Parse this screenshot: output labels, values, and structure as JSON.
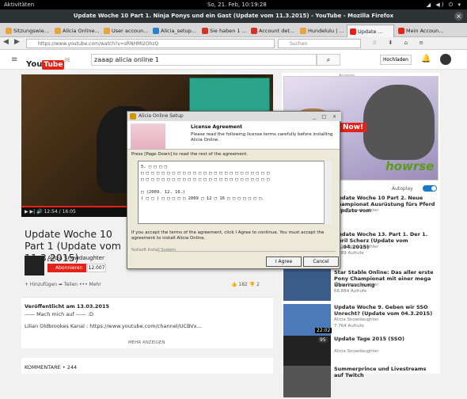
{
  "desktop": {
    "activities": "Aktivitäten",
    "clock": "So, 21. Feb, 10:19:28",
    "sys_icons": "◢ ◀) ⏻ ▾"
  },
  "window": {
    "title": "Update Woche 10 Part 1. Ninja Ponys und ein Gast (Update vom 11.3.2015) - YouTube - Mozilla Firefox",
    "close": "×"
  },
  "tabs": [
    {
      "label": "Sitzungswie...",
      "color": "#e8a33d"
    },
    {
      "label": "Alicia Online...",
      "color": "#e8a33d"
    },
    {
      "label": "User accoun...",
      "color": "#e8a33d"
    },
    {
      "label": "Alicia_setup...",
      "color": "#2a7fd1"
    },
    {
      "label": "Sie haben 1 ...",
      "color": "#d93025"
    },
    {
      "label": "Account det...",
      "color": "#d93025"
    },
    {
      "label": "Hundelulu | ...",
      "color": "#e8a33d"
    },
    {
      "label": "Update ...",
      "color": "#e62117"
    },
    {
      "label": "Mein Accoun...",
      "color": "#e62117"
    }
  ],
  "tab_new": "+",
  "tab_menu": "▾",
  "nav": {
    "back": "◀",
    "forward": "▶",
    "url": "https://www.youtube.com/watch?v=sRNHMI2OhzQ",
    "search_placeholder": "Suchen",
    "tools": "☆ ⬇ ⌂ ≡"
  },
  "youtube": {
    "logo_you": "You",
    "logo_tube": "Tube",
    "logo_region": "DE",
    "search_value": "zaaap alicia online 1",
    "upload": "Hochladen"
  },
  "video": {
    "time": "▶  ▶|  🔊   12:54 / 16:05",
    "progress_fraction": 0.6,
    "title": "Update Woche 10 Part 1 (Update vom 11.3.2015)",
    "channel": "Alicia Snowdaughter",
    "subscribe": "Abonnieren",
    "subscribers": "12.007",
    "actions": "+ Hinzufügen    ➦ Teilen    ••• Mehr",
    "likes": "👍 182    👎 2",
    "published": "Veröffentlicht am 13.03.2015",
    "desc1": "—— Mach mich auf —— :D",
    "desc2": "Lilian Oldbrookes Kanal : https://www.youtube.com/channel/UCBVx...",
    "more": "MEHR ANZEIGEN",
    "comments": "KOMMENTARE • 244"
  },
  "sidebar": {
    "ad_label": "Anzeige",
    "ad_now": "Now!",
    "ad_brand": "howrse",
    "autoplay": "Autoplay",
    "recs": [
      {
        "title": "Update Woche 10 Part 2. Neue Championat Ausrüstung fürs Pferd (Update vom",
        "channel": "Alicia Snowdaughter",
        "views": "",
        "dur": "",
        "color": "#3a2a1a"
      },
      {
        "title": "Update Woche 13. Part 1. Der 1. April Scherz (Update vom 01.04.2015)",
        "channel": "Alicia Snowdaughter",
        "views": "6.289 Aufrufe",
        "dur": "",
        "color": "#5a6b3a"
      },
      {
        "title": "Star Stable Online: Das aller erste Pony Championat mit einer mega Überraschung",
        "channel": "Alicia Snowdaughter",
        "views": "66.884 Aufrufe",
        "dur": "",
        "color": "#3b5c8a"
      },
      {
        "title": "Update Woche 9. Geben wir SSO Unrecht? (Update vom 04.3.2015)",
        "channel": "Alicia Snowdaughter",
        "views": "7.764 Aufrufe",
        "dur": "22:02",
        "color": "#4a7ab8"
      },
      {
        "title": "Update Tage 2015 (SSO)",
        "channel": "Alicia Snowdaughter",
        "views": "",
        "dur": "",
        "color": "#222"
      },
      {
        "title": "Summerprince und Livestreams auf Twitch",
        "channel": "",
        "views": "",
        "dur": "",
        "color": "#555"
      }
    ],
    "rec_badge": "95"
  },
  "dialog": {
    "title": "Alicia Online Setup",
    "buttons": "_ □ ×",
    "head1": "License Agreement",
    "head2": "Please read the following license terms carefully before installing Alicia Online.",
    "instr": "Press [Page Down] to read the rest of the agreement.",
    "text_lines": [
      "5. □ □ □ □",
      "□ □ □ □ □ □ □ □ □ □ □ □ □ □ □ □ □ □ □ □ □ □ □ □ □",
      "□ □ □ □ □ □ □ □ □ □ □ □ □ □ □ □ □ □ □ □ □ □ □ □ □",
      "",
      "□ (2009. 12. 16.)",
      "( □ □ ) □ □ □ □ □ 2009 □ 12 □ 16 □ □ □ □ □ □ □."
    ],
    "question": "If you accept the terms of the agreement, click I Agree to continue. You must accept the agreement to install Alicia Online.",
    "footer": "Nullsoft Install System",
    "agree": "I Agree",
    "cancel": "Cancel"
  }
}
